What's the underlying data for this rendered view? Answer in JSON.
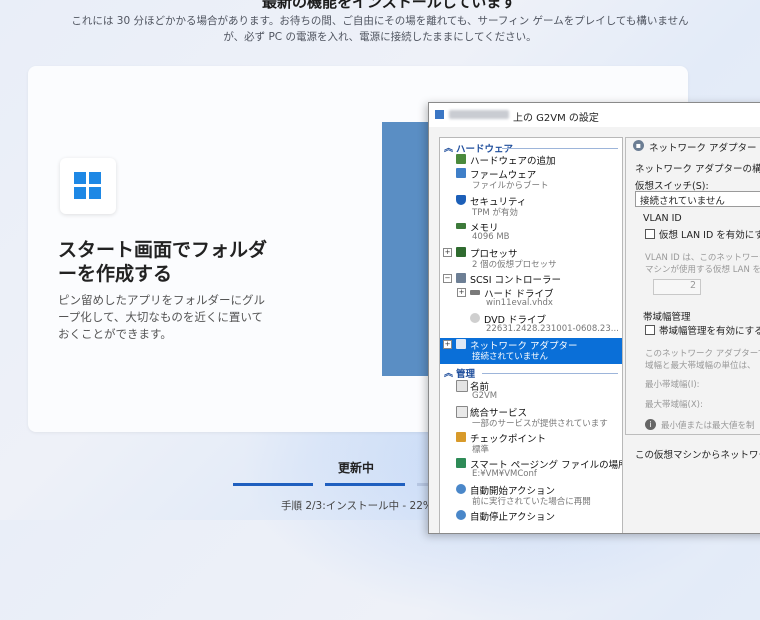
{
  "page": {
    "top_title": "最新の機能をインストールしています",
    "desc_line1": "これには 30 分ほどかかる場合があります。お待ちの間、ご自由にその場を離れても、サーフィン ゲームをプレイしても構いません",
    "desc_line2": "が、必ず PC の電源を入れ、電源に接続したままにしてください。"
  },
  "card": {
    "title": "スタート画面でフォルダーを作成する",
    "desc": "ピン留めしたアプリをフォルダーにグループ化して、大切なものを近くに置いておくことができます。"
  },
  "status": {
    "updating": "更新中",
    "step": "手順 2/3:インストール中 - 22%",
    "progress_fraction": 0.22
  },
  "window": {
    "title": "上の G2VM の設定",
    "sections": {
      "hardware": "ハードウェア",
      "management": "管理"
    },
    "hardware_items": [
      {
        "name": "ハードウェアの追加",
        "sub": ""
      },
      {
        "name": "ファームウェア",
        "sub": "ファイルからブート"
      },
      {
        "name": "セキュリティ",
        "sub": "TPM が有効"
      },
      {
        "name": "メモリ",
        "sub": "4096 MB"
      },
      {
        "name": "プロセッサ",
        "sub": "2 個の仮想プロセッサ"
      },
      {
        "name": "SCSI コントローラー",
        "sub": ""
      },
      {
        "name": "ハード ドライブ",
        "sub": "win11eval.vhdx"
      },
      {
        "name": "DVD ドライブ",
        "sub": "22631.2428.231001-0608.23..."
      },
      {
        "name": "ネットワーク アダプター",
        "sub": "接続されていません"
      }
    ],
    "management_items": [
      {
        "name": "名前",
        "sub": "G2VM"
      },
      {
        "name": "統合サービス",
        "sub": "一部のサービスが提供されています"
      },
      {
        "name": "チェックポイント",
        "sub": "標準"
      },
      {
        "name": "スマート ページング ファイルの場所",
        "sub": "E:¥VM¥VMConf"
      },
      {
        "name": "自動開始アクション",
        "sub": "前に実行されていた場合に再開"
      },
      {
        "name": "自動停止アクション",
        "sub": ""
      }
    ],
    "right": {
      "header": "ネットワーク アダプター",
      "config_label": "ネットワーク アダプターの構成を指定",
      "switch_label": "仮想スイッチ(S):",
      "switch_value": "接続されていません",
      "vlan_group": "VLAN ID",
      "vlan_checkbox": "仮想 LAN ID を有効にする",
      "vlan_desc1": "VLAN ID は、このネットワーク ア",
      "vlan_desc2": "マシンが使用する仮想 LAN を指",
      "vlan_value": "2",
      "bw_group": "帯域幅管理",
      "bw_checkbox": "帯域幅管理を有効にする(",
      "bw_desc1": "このネットワーク アダプターでの",
      "bw_desc2": "域幅と最大帯域幅の単位は、",
      "min_bw": "最小帯域幅(I):",
      "max_bw": "最大帯域幅(X):",
      "info_text": "最小値または最大値を制",
      "footer": "この仮想マシンからネットワーク アダ"
    }
  },
  "colors": {
    "accent": "#0a6fd8",
    "progress": "#1f5fbf"
  }
}
